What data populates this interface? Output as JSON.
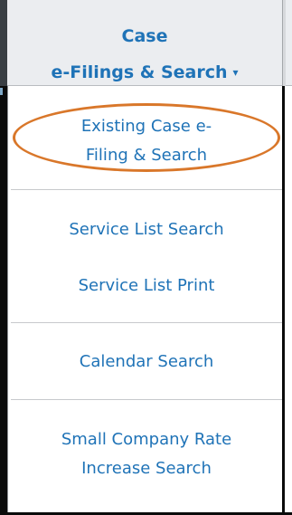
{
  "menu": {
    "title_line1": "Case",
    "title_line2": "e-Filings & Search",
    "caret": "▾",
    "items": [
      {
        "line1": "Existing Case e-",
        "line2": "Filing & Search"
      },
      {
        "line1": "Service List Search"
      },
      {
        "line1": "Service List Print"
      },
      {
        "line1": "Calendar Search"
      },
      {
        "line1": "Small Company Rate",
        "line2": "Increase Search"
      }
    ]
  },
  "colors": {
    "link": "#1f73b7",
    "highlight": "#d9772a",
    "header_bg": "#ebedf0"
  }
}
